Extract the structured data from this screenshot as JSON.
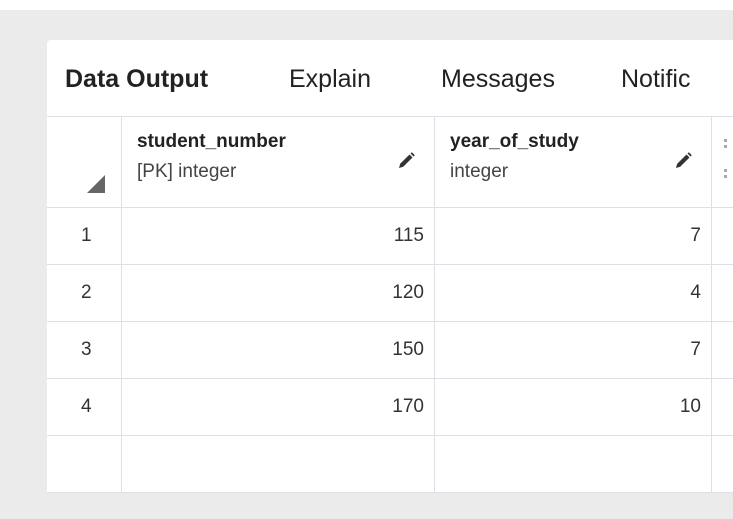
{
  "tabs": [
    {
      "label": "Data Output"
    },
    {
      "label": "Explain"
    },
    {
      "label": "Messages"
    },
    {
      "label": "Notific"
    }
  ],
  "columns": [
    {
      "name": "student_number",
      "type": "[PK] integer"
    },
    {
      "name": "year_of_study",
      "type": "integer"
    }
  ],
  "rows": [
    {
      "num": "1",
      "student_number": "115",
      "year_of_study": "7"
    },
    {
      "num": "2",
      "student_number": "120",
      "year_of_study": "4"
    },
    {
      "num": "3",
      "student_number": "150",
      "year_of_study": "7"
    },
    {
      "num": "4",
      "student_number": "170",
      "year_of_study": "10"
    }
  ],
  "icons": {
    "edit": "pencil-icon",
    "sort": "corner-triangle-icon"
  },
  "colors": {
    "background": "#ebebeb",
    "grid_line": "#dde0e6",
    "text": "#222222"
  }
}
